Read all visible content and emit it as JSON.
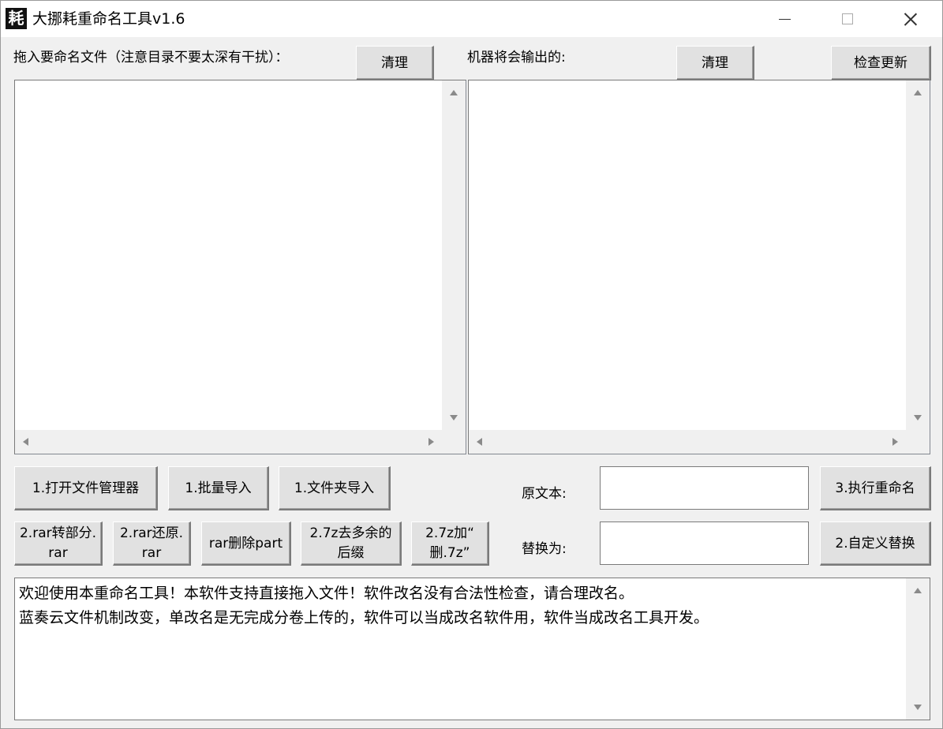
{
  "window": {
    "icon_glyph": "耗",
    "title": "大挪耗重命名工具v1.6"
  },
  "top": {
    "left_label": "拖入要命名文件（注意目录不要太深有干扰）：",
    "left_clear": "清理",
    "right_label": "机器将会输出的:",
    "right_clear": "清理",
    "check_update": "检查更新"
  },
  "row1": {
    "open_explorer": "1.打开文件管理器",
    "batch_import": "1.批量导入",
    "folder_import": "1.文件夹导入",
    "original_text_label": "原文本:",
    "original_text_value": "",
    "execute_rename": "3.执行重命名"
  },
  "row2": {
    "rar_to_part": "2.rar转部分.\nrar",
    "rar_restore": "2.rar还原.\nrar",
    "rar_delete_part": "rar删除part",
    "remove_7z_suffix": "2.7z去多余的\n后缀",
    "add_del_7z": "2.7z加“\n删.7z”",
    "replace_with_label": "替换为:",
    "replace_with_value": "",
    "custom_replace": "2.自定义替换"
  },
  "log": {
    "text": "欢迎使用本重命名工具！本软件支持直接拖入文件！软件改名没有合法性检查，请合理改名。\n蓝奏云文件机制改变，单改名是无完成分卷上传的，软件可以当成改名软件用，软件当成改名工具开发。"
  }
}
